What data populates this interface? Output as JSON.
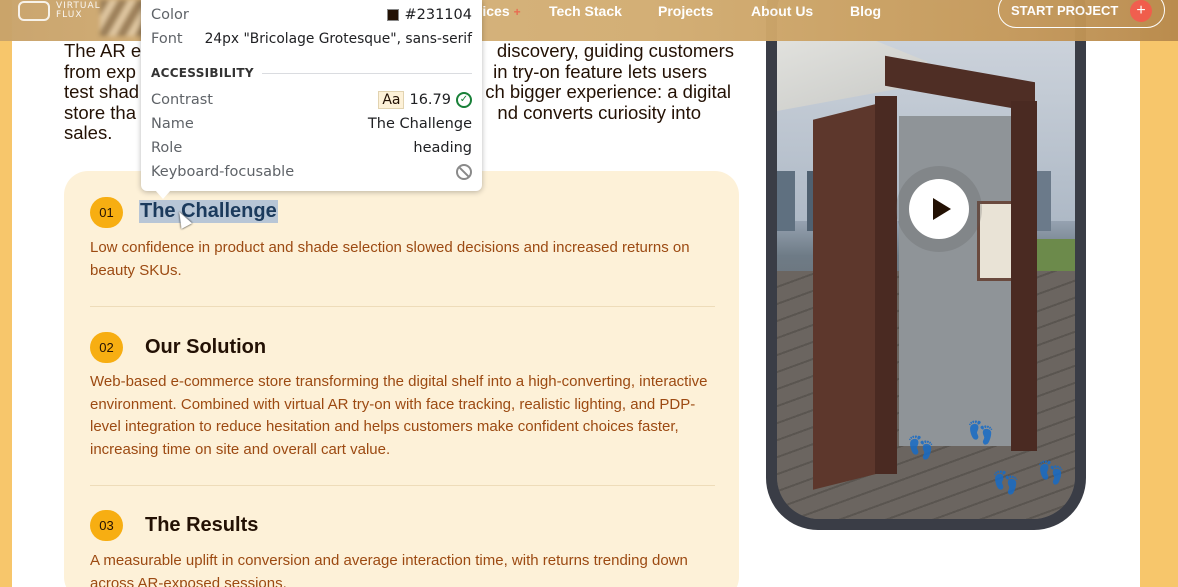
{
  "nav": {
    "logo_text_1": "VIRTUAL",
    "logo_text_2": "FLUX",
    "links": [
      {
        "label": "Services",
        "plus": "+"
      },
      {
        "label": "Tech Stack"
      },
      {
        "label": "Projects"
      },
      {
        "label": "About Us"
      },
      {
        "label": "Blog"
      }
    ],
    "cta_label": "START PROJECT",
    "cta_plus": "+"
  },
  "intro": {
    "line_1_start": "The AR e",
    "line_1_end": "discovery, guiding customers",
    "line_2_start": "from exp",
    "line_2_end": "in try-on feature lets users",
    "line_3_start": "test shad",
    "line_3_end": "ch bigger experience: a digital",
    "line_4_start": "store tha",
    "line_4_end": "nd converts curiosity into",
    "line_5": "sales."
  },
  "items": [
    {
      "number": "01",
      "title": "The Challenge",
      "text": "Low confidence in product and shade selection slowed decisions and increased returns on beauty SKUs."
    },
    {
      "number": "02",
      "title": "Our Solution",
      "text": "Web-based e-commerce store transforming the digital shelf into a high-converting, interactive environment. Combined with virtual AR try-on with face tracking, realistic lighting, and PDP-level integration to reduce hesitation and helps customers make confident choices faster, increasing time on site and overall cart value."
    },
    {
      "number": "03",
      "title": "The Results",
      "text": "A measurable uplift in conversion and average interaction time, with returns trending down across AR-exposed sessions."
    }
  ],
  "inspector": {
    "color_label": "Color",
    "color_value": "#231104",
    "font_label": "Font",
    "font_value": "24px \"Bricolage Grotesque\", sans-serif",
    "section_title": "ACCESSIBILITY",
    "contrast_label": "Contrast",
    "contrast_aa": "Aa",
    "contrast_value": "16.79",
    "name_label": "Name",
    "name_value": "The Challenge",
    "role_label": "Role",
    "role_value": "heading",
    "focus_label": "Keyboard-focusable"
  },
  "colors": {
    "text": "#231104",
    "accent_orange": "#f7ae12",
    "body_text": "#9c4a12",
    "card_bg": "#fdf1d8",
    "cta_plus": "#f05a4a"
  },
  "icons": {
    "play": "play-icon",
    "check": "check-circle-icon",
    "no_focus": "prohibited-icon",
    "cursor": "mouse-cursor-icon"
  }
}
